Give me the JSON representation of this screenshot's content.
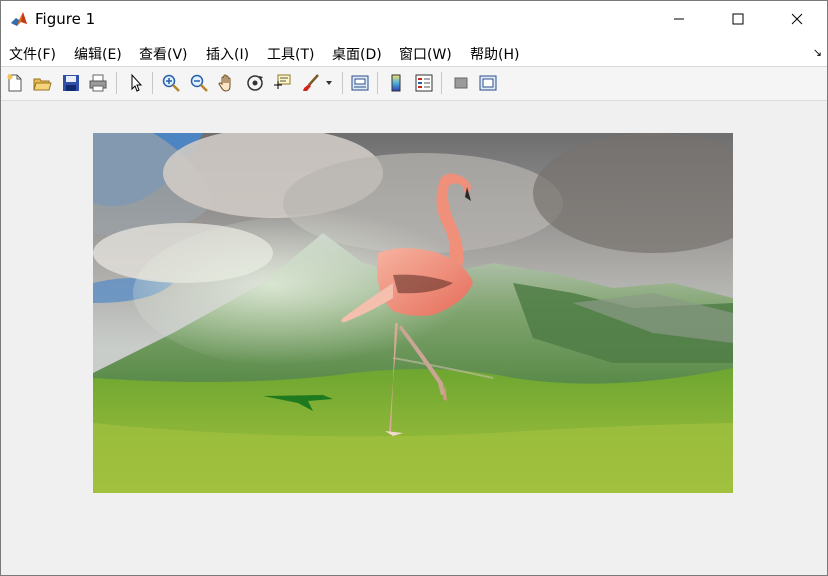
{
  "window": {
    "title": "Figure 1"
  },
  "menu": {
    "file": "文件(F)",
    "edit": "编辑(E)",
    "view": "查看(V)",
    "insert": "插入(I)",
    "tools": "工具(T)",
    "desktop": "桌面(D)",
    "window": "窗口(W)",
    "help": "帮助(H)",
    "corner": "↘"
  },
  "toolbar": {
    "buttons": [
      "new-figure",
      "open-file",
      "save",
      "print",
      "select",
      "zoom-in",
      "zoom-out",
      "pan",
      "rotate-3d",
      "data-cursor",
      "brush",
      "brush-dropdown",
      "link-plot",
      "colorbar",
      "legend",
      "hide-plot-tools",
      "show-plot-tools"
    ]
  },
  "figure": {
    "content": "flamingo composited over green mountain landscape",
    "colors": {
      "sky": "#7d8fa3",
      "grass": "#6fa832",
      "flamingo": "#f0907a",
      "shadow": "#1f7a1f"
    }
  }
}
